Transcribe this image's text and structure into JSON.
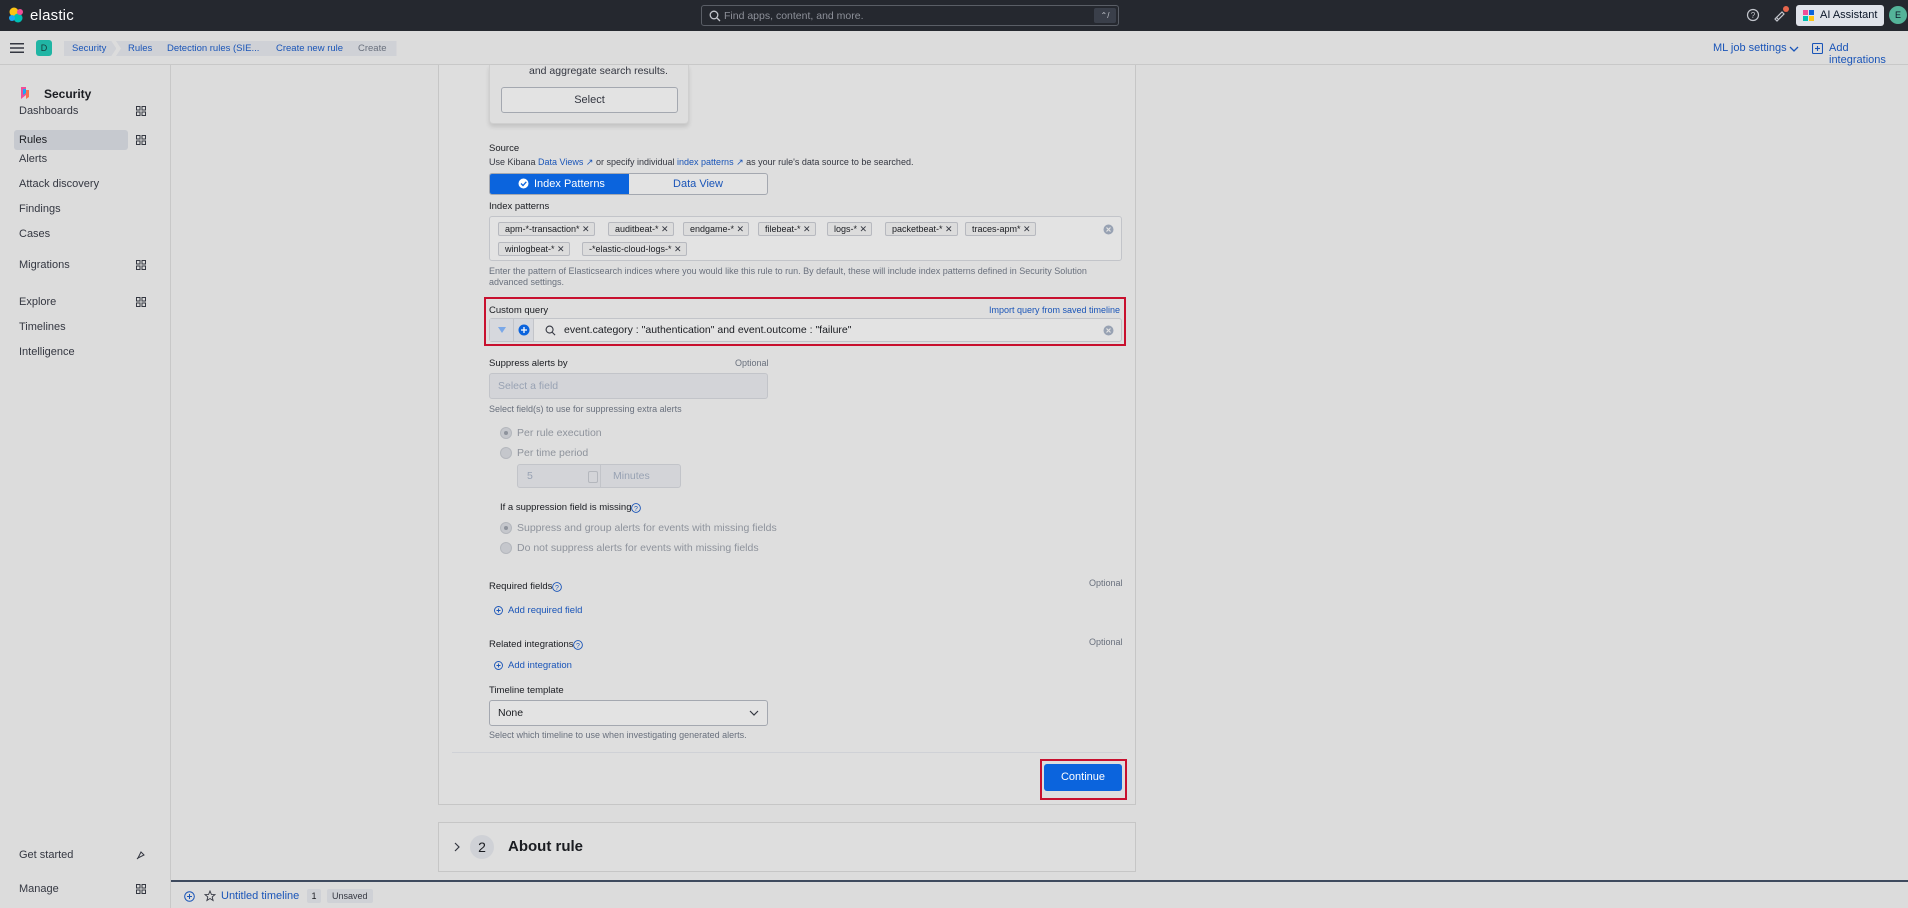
{
  "header": {
    "brand": "elastic",
    "search_placeholder": "Find apps, content, and more.",
    "search_shortcut": "⌃/",
    "ai_assistant_label": "AI Assistant",
    "avatar_initial": "E"
  },
  "subheader": {
    "space_initial": "D",
    "breadcrumbs": [
      "Security",
      "Rules",
      "Detection rules (SIE...",
      "Create new rule",
      "Create"
    ],
    "ml_job_settings": "ML job settings",
    "add_integrations": "Add integrations"
  },
  "sidebar": {
    "title": "Security",
    "items": [
      {
        "label": "Dashboards"
      },
      {
        "label": "Rules"
      },
      {
        "label": "Alerts"
      },
      {
        "label": "Attack discovery"
      },
      {
        "label": "Findings"
      },
      {
        "label": "Cases"
      },
      {
        "label": "Migrations"
      },
      {
        "label": "Explore"
      },
      {
        "label": "Timelines"
      },
      {
        "label": "Intelligence"
      }
    ],
    "footer": [
      {
        "label": "Get started"
      },
      {
        "label": "Manage"
      }
    ]
  },
  "form": {
    "card_text": "and aggregate search results.",
    "select_button": "Select",
    "source_label": "Source",
    "source_help_prefix": "Use Kibana",
    "source_link_dataviews": "Data Views",
    "source_help_mid": "or specify individual",
    "source_link_index_patterns": "index patterns",
    "source_help_suffix": "as your rule's data source to be searched.",
    "tab_index_patterns": "Index Patterns",
    "tab_data_view": "Data View",
    "index_patterns_label": "Index patterns",
    "index_patterns": [
      "apm-*-transaction*",
      "auditbeat-*",
      "endgame-*",
      "filebeat-*",
      "logs-*",
      "packetbeat-*",
      "traces-apm*",
      "winlogbeat-*",
      "-*elastic-cloud-logs-*"
    ],
    "index_help_line1": "Enter the pattern of Elasticsearch indices where you would like this rule to run. By default, these will include index patterns defined in Security Solution",
    "index_help_line2": "advanced settings.",
    "custom_query_label": "Custom query",
    "import_query_link": "Import query from saved timeline",
    "custom_query_value": "event.category : \"authentication\" and event.outcome : \"failure\"",
    "suppress_label": "Suppress alerts by",
    "optional": "Optional",
    "suppress_placeholder": "Select a field",
    "suppress_help": "Select field(s) to use for suppressing extra alerts",
    "per_rule_execution": "Per rule execution",
    "per_time_period": "Per time period",
    "period_value": "5",
    "period_unit": "Minutes",
    "missing_label": "If a suppression field is missing",
    "missing_opt1": "Suppress and group alerts for events with missing fields",
    "missing_opt2": "Do not suppress alerts for events with missing fields",
    "required_fields_label": "Required fields",
    "add_required_field": "Add required field",
    "related_integrations_label": "Related integrations",
    "add_integration": "Add integration",
    "timeline_template_label": "Timeline template",
    "timeline_template_value": "None",
    "timeline_template_help": "Select which timeline to use when investigating generated alerts.",
    "continue_button": "Continue"
  },
  "about": {
    "step_number": "2",
    "title": "About rule"
  },
  "timeline": {
    "name": "Untitled timeline",
    "count": "1",
    "status": "Unsaved"
  }
}
